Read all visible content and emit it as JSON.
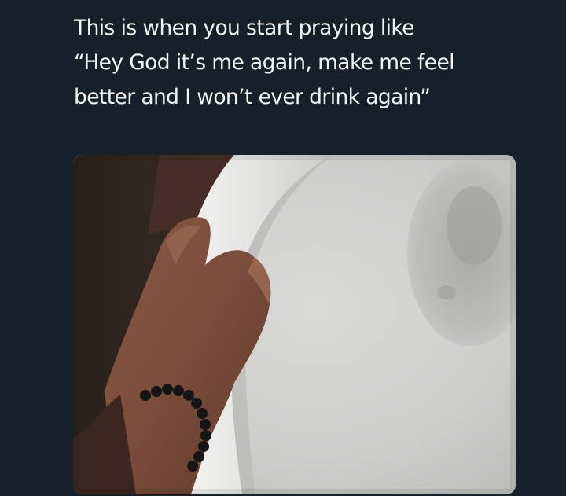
{
  "tweet": {
    "lines": [
      "This is when you start praying like",
      "“Hey God it’s me again, make me feel",
      "better and I won’t ever drink again”"
    ]
  },
  "colors": {
    "background": "#16202b",
    "text": "#f2f4f6"
  }
}
